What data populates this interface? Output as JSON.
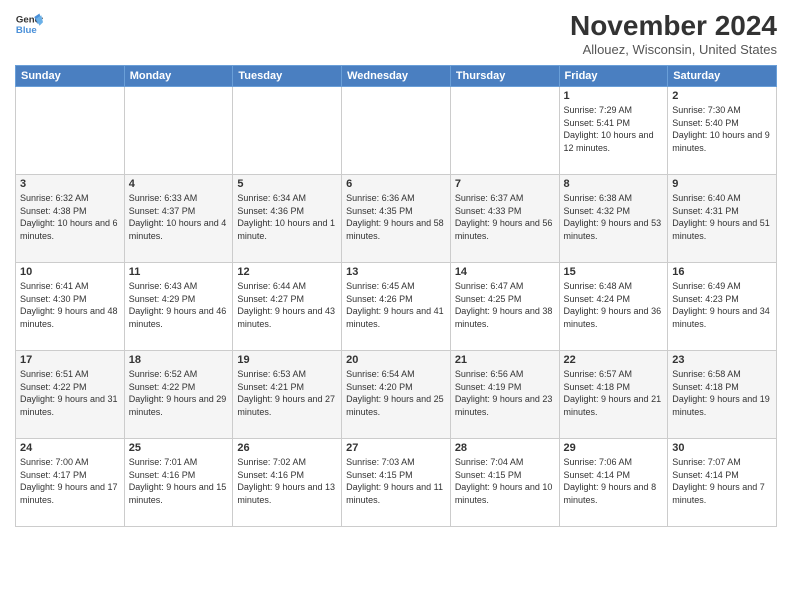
{
  "header": {
    "logo_line1": "General",
    "logo_line2": "Blue",
    "month_title": "November 2024",
    "location": "Allouez, Wisconsin, United States"
  },
  "weekdays": [
    "Sunday",
    "Monday",
    "Tuesday",
    "Wednesday",
    "Thursday",
    "Friday",
    "Saturday"
  ],
  "weeks": [
    [
      {
        "day": "",
        "info": ""
      },
      {
        "day": "",
        "info": ""
      },
      {
        "day": "",
        "info": ""
      },
      {
        "day": "",
        "info": ""
      },
      {
        "day": "",
        "info": ""
      },
      {
        "day": "1",
        "info": "Sunrise: 7:29 AM\nSunset: 5:41 PM\nDaylight: 10 hours and 12 minutes."
      },
      {
        "day": "2",
        "info": "Sunrise: 7:30 AM\nSunset: 5:40 PM\nDaylight: 10 hours and 9 minutes."
      }
    ],
    [
      {
        "day": "3",
        "info": "Sunrise: 6:32 AM\nSunset: 4:38 PM\nDaylight: 10 hours and 6 minutes."
      },
      {
        "day": "4",
        "info": "Sunrise: 6:33 AM\nSunset: 4:37 PM\nDaylight: 10 hours and 4 minutes."
      },
      {
        "day": "5",
        "info": "Sunrise: 6:34 AM\nSunset: 4:36 PM\nDaylight: 10 hours and 1 minute."
      },
      {
        "day": "6",
        "info": "Sunrise: 6:36 AM\nSunset: 4:35 PM\nDaylight: 9 hours and 58 minutes."
      },
      {
        "day": "7",
        "info": "Sunrise: 6:37 AM\nSunset: 4:33 PM\nDaylight: 9 hours and 56 minutes."
      },
      {
        "day": "8",
        "info": "Sunrise: 6:38 AM\nSunset: 4:32 PM\nDaylight: 9 hours and 53 minutes."
      },
      {
        "day": "9",
        "info": "Sunrise: 6:40 AM\nSunset: 4:31 PM\nDaylight: 9 hours and 51 minutes."
      }
    ],
    [
      {
        "day": "10",
        "info": "Sunrise: 6:41 AM\nSunset: 4:30 PM\nDaylight: 9 hours and 48 minutes."
      },
      {
        "day": "11",
        "info": "Sunrise: 6:43 AM\nSunset: 4:29 PM\nDaylight: 9 hours and 46 minutes."
      },
      {
        "day": "12",
        "info": "Sunrise: 6:44 AM\nSunset: 4:27 PM\nDaylight: 9 hours and 43 minutes."
      },
      {
        "day": "13",
        "info": "Sunrise: 6:45 AM\nSunset: 4:26 PM\nDaylight: 9 hours and 41 minutes."
      },
      {
        "day": "14",
        "info": "Sunrise: 6:47 AM\nSunset: 4:25 PM\nDaylight: 9 hours and 38 minutes."
      },
      {
        "day": "15",
        "info": "Sunrise: 6:48 AM\nSunset: 4:24 PM\nDaylight: 9 hours and 36 minutes."
      },
      {
        "day": "16",
        "info": "Sunrise: 6:49 AM\nSunset: 4:23 PM\nDaylight: 9 hours and 34 minutes."
      }
    ],
    [
      {
        "day": "17",
        "info": "Sunrise: 6:51 AM\nSunset: 4:22 PM\nDaylight: 9 hours and 31 minutes."
      },
      {
        "day": "18",
        "info": "Sunrise: 6:52 AM\nSunset: 4:22 PM\nDaylight: 9 hours and 29 minutes."
      },
      {
        "day": "19",
        "info": "Sunrise: 6:53 AM\nSunset: 4:21 PM\nDaylight: 9 hours and 27 minutes."
      },
      {
        "day": "20",
        "info": "Sunrise: 6:54 AM\nSunset: 4:20 PM\nDaylight: 9 hours and 25 minutes."
      },
      {
        "day": "21",
        "info": "Sunrise: 6:56 AM\nSunset: 4:19 PM\nDaylight: 9 hours and 23 minutes."
      },
      {
        "day": "22",
        "info": "Sunrise: 6:57 AM\nSunset: 4:18 PM\nDaylight: 9 hours and 21 minutes."
      },
      {
        "day": "23",
        "info": "Sunrise: 6:58 AM\nSunset: 4:18 PM\nDaylight: 9 hours and 19 minutes."
      }
    ],
    [
      {
        "day": "24",
        "info": "Sunrise: 7:00 AM\nSunset: 4:17 PM\nDaylight: 9 hours and 17 minutes."
      },
      {
        "day": "25",
        "info": "Sunrise: 7:01 AM\nSunset: 4:16 PM\nDaylight: 9 hours and 15 minutes."
      },
      {
        "day": "26",
        "info": "Sunrise: 7:02 AM\nSunset: 4:16 PM\nDaylight: 9 hours and 13 minutes."
      },
      {
        "day": "27",
        "info": "Sunrise: 7:03 AM\nSunset: 4:15 PM\nDaylight: 9 hours and 11 minutes."
      },
      {
        "day": "28",
        "info": "Sunrise: 7:04 AM\nSunset: 4:15 PM\nDaylight: 9 hours and 10 minutes."
      },
      {
        "day": "29",
        "info": "Sunrise: 7:06 AM\nSunset: 4:14 PM\nDaylight: 9 hours and 8 minutes."
      },
      {
        "day": "30",
        "info": "Sunrise: 7:07 AM\nSunset: 4:14 PM\nDaylight: 9 hours and 7 minutes."
      }
    ]
  ]
}
